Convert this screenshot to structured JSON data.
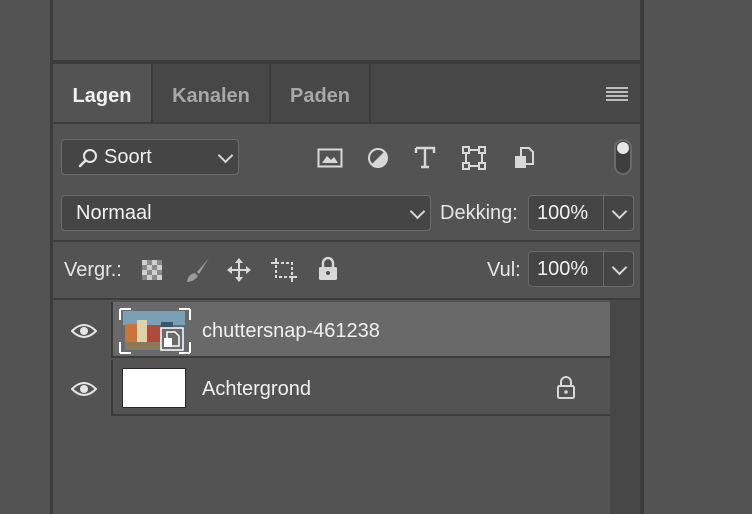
{
  "tabs": [
    {
      "label": "Lagen",
      "active": true
    },
    {
      "label": "Kanalen",
      "active": false
    },
    {
      "label": "Paden",
      "active": false
    }
  ],
  "filter": {
    "kind_label": "Soort",
    "icons": [
      "image-filter-icon",
      "adjustment-filter-icon",
      "type-filter-icon",
      "shape-filter-icon",
      "smart-object-filter-icon"
    ]
  },
  "blend": {
    "mode": "Normaal",
    "opacity_label": "Dekking:",
    "opacity_value": "100%"
  },
  "lock": {
    "label": "Vergr.:",
    "icons": [
      "lock-transparent-icon",
      "lock-image-icon",
      "lock-position-icon",
      "lock-artboard-icon",
      "lock-all-icon"
    ],
    "fill_label": "Vul:",
    "fill_value": "100%"
  },
  "layers": [
    {
      "name": "chuttersnap-461238",
      "visible": true,
      "selected": true,
      "smart_object": true,
      "locked": false
    },
    {
      "name": "Achtergrond",
      "visible": true,
      "selected": false,
      "smart_object": false,
      "locked": true
    }
  ],
  "colors": {
    "panel_bg": "#535353",
    "tab_bar_bg": "#474747",
    "selected_row": "#696969",
    "divider": "#3c3c3c"
  }
}
